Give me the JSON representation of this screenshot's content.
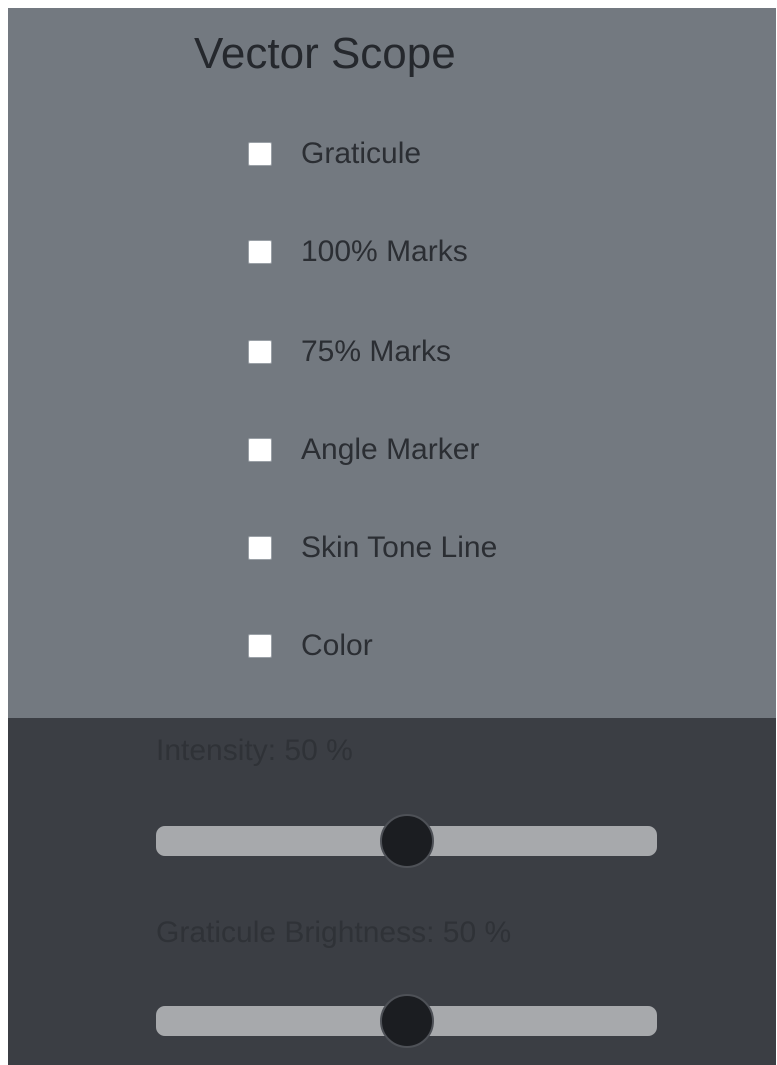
{
  "panel": {
    "title": "Vector Scope"
  },
  "options": [
    {
      "label": "Graticule",
      "checked": false
    },
    {
      "label": "100% Marks",
      "checked": false
    },
    {
      "label": "75% Marks",
      "checked": false
    },
    {
      "label": "Angle Marker",
      "checked": false
    },
    {
      "label": "Skin Tone Line",
      "checked": false
    },
    {
      "label": "Color",
      "checked": false
    }
  ],
  "sliders": {
    "intensity": {
      "label": "Intensity: 50 %",
      "value_percent": 50
    },
    "graticule_brightness": {
      "label": "Graticule Brightness: 50 %",
      "value_percent": 50
    }
  },
  "colors": {
    "top_panel": "#737980",
    "bottom_panel": "#3b3e44",
    "slider_track": "#a7a9ac",
    "slider_thumb": "#1b1d21"
  }
}
